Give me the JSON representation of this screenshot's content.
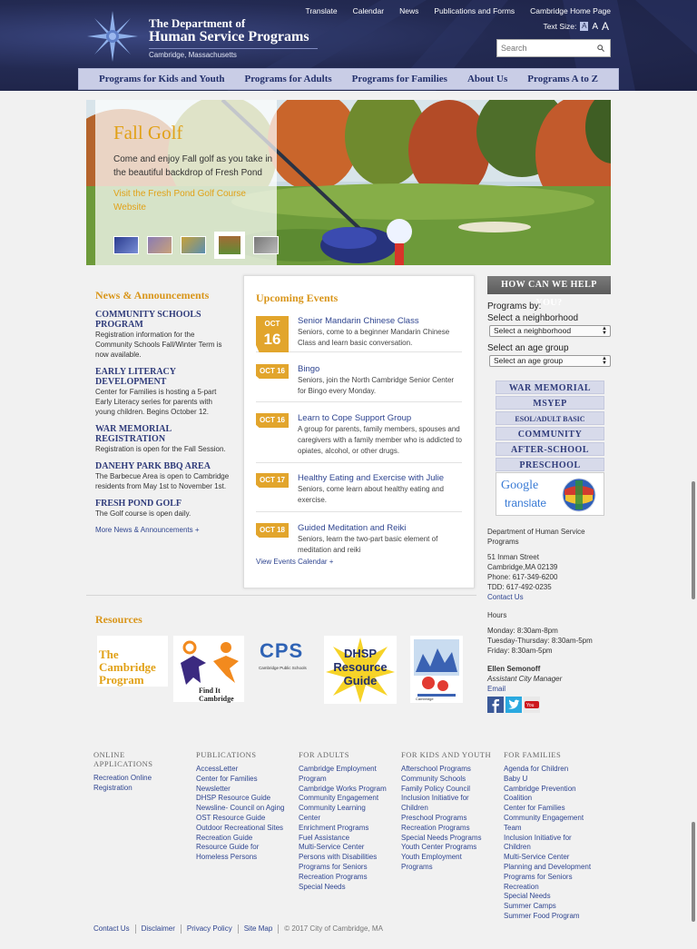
{
  "header": {
    "org_line1": "The Department of",
    "org_line2": "Human Service Programs",
    "org_line3": "Cambridge, Massachusetts",
    "util_nav": [
      "Translate",
      "Calendar",
      "News",
      "Publications and Forms",
      "Cambridge Home Page"
    ],
    "text_size_label": "Text Size:",
    "text_size_options": [
      "A",
      "A",
      "A"
    ],
    "search_placeholder": "Search"
  },
  "main_nav": [
    "Programs for Kids and Youth",
    "Programs for Adults",
    "Programs for Families",
    "About Us",
    "Programs A to Z"
  ],
  "hero": {
    "title": "Fall Golf",
    "text": "Come and enjoy Fall golf as you take in the beautiful backdrop of Fresh Pond",
    "link": "Visit the Fresh Pond Golf Course Website"
  },
  "news": {
    "heading": "News & Announcements",
    "items": [
      {
        "title": "Community Schools Program",
        "body": "Registration information for the Community Schools Fall/Winter Term is now available."
      },
      {
        "title": "Early Literacy Development",
        "body": "Center for Families is hosting a 5-part Early Literacy series for parents with young children. Begins October 12."
      },
      {
        "title": "War Memorial Registration",
        "body": "Registration is open for the Fall Session."
      },
      {
        "title": "Danehy Park BBQ Area",
        "body": "The Barbecue Area is open to Cambridge residents from May 1st to November 1st."
      },
      {
        "title": "Fresh Pond Golf",
        "body": "The Golf course is open daily."
      }
    ],
    "more": "More News & Announcements +"
  },
  "events": {
    "heading": "Upcoming Events",
    "items": [
      {
        "month": "OCT",
        "day": "16",
        "date": "OCT 16",
        "title": "Senior Mandarin Chinese Class",
        "body": "Seniors, come to a beginner Mandarin Chinese Class and learn basic conversation."
      },
      {
        "date": "OCT 16",
        "title": "Bingo",
        "body": "Seniors, join the North Cambridge Senior Center for Bingo every Monday."
      },
      {
        "date": "OCT 16",
        "title": "Learn to Cope Support Group",
        "body": "A group for parents, family members, spouses and caregivers with a family member who is addicted to opiates, alcohol, or other drugs."
      },
      {
        "date": "OCT 17",
        "title": "Healthy Eating and Exercise with Julie",
        "body": "Seniors, come learn about healthy eating and exercise."
      },
      {
        "date": "OCT 18",
        "title": "Guided Meditation and Reiki",
        "body": "Seniors, learn the two-part basic element of meditation and reiki"
      }
    ],
    "more": "View Events Calendar +"
  },
  "sidebar": {
    "help": "HOW CAN WE HELP YOU?",
    "programs_by": "Programs by:",
    "neighborhood_label": "Select a neighborhood",
    "neighborhood_value": "Select a neighborhood",
    "age_label": "Select an age group",
    "age_value": "Select an age group",
    "program_buttons": [
      "WAR MEMORIAL",
      "MSYEP",
      "ESOL/ADULT BASIC EDUCATION",
      "COMMUNITY SCHOOLS",
      "AFTER-SCHOOL",
      "PRESCHOOL"
    ],
    "google": "Google",
    "translate": "translate",
    "contact": {
      "org": "Department of Human Service Programs",
      "address1": "51 Inman Street",
      "address2": "Cambridge,MA 02139",
      "phone": "Phone: 617-349-6200",
      "tdd": "TDD: 617-492-0235",
      "contact_link": "Contact Us",
      "hours_heading": "Hours",
      "hours1": "Monday: 8:30am-8pm",
      "hours2": "Tuesday-Thursday: 8:30am-5pm",
      "hours3": "Friday: 8:30am-5pm",
      "name": "Ellen Semonoff",
      "role": "Assistant City Manager",
      "email": "Email"
    }
  },
  "resources": {
    "heading": "Resources",
    "logos": [
      {
        "text": "The Cambridge Program"
      },
      {
        "text": "Find It Cambridge"
      },
      {
        "text": "CPS",
        "sub": "Cambridge Public Schools"
      },
      {
        "text": "DHSP Resource Guide"
      },
      {
        "text": "Cambridge"
      }
    ]
  },
  "footer": {
    "columns": [
      {
        "heading": "Online Applications",
        "links": [
          "Recreation Online Registration"
        ]
      },
      {
        "heading": "Publications",
        "links": [
          "AccessLetter",
          "Center for Families Newsletter",
          "DHSP Resource Guide",
          "Newsline- Council on Aging",
          "OST Resource Guide",
          "Outdoor Recreational Sites",
          "Recreation Guide",
          "Resource Guide for Homeless Persons"
        ]
      },
      {
        "heading": "For Adults",
        "links": [
          "Cambridge Employment Program",
          "Cambridge Works Program",
          "Community Engagement",
          "Community Learning Center",
          "Enrichment Programs",
          "Fuel Assistance",
          "Multi-Service Center",
          "Persons with Disabilities",
          "Programs for Seniors",
          "Recreation Programs",
          "Special Needs"
        ]
      },
      {
        "heading": "For Kids and Youth",
        "links": [
          "Afterschool Programs",
          "Community Schools",
          "Family Policy Council",
          "Inclusion Initiative for Children",
          "Preschool Programs",
          "Recreation Programs",
          "Special Needs Programs",
          "Youth Center Programs",
          "Youth Employment Programs"
        ]
      },
      {
        "heading": "For Families",
        "links": [
          "Agenda for Children",
          "Baby U",
          "Cambridge Prevention Coalition",
          "Center for Families",
          "Community Engagement Team",
          "Inclusion Initiative for Children",
          "Multi-Service Center",
          "Planning and Development",
          "Programs for Seniors",
          "Recreation",
          "Special Needs",
          "Summer Camps",
          "Summer Food Program"
        ]
      }
    ],
    "legal": [
      "Contact Us",
      "Disclaimer",
      "Privacy Policy",
      "Site Map"
    ],
    "copyright": "© 2017 City of Cambridge, MA"
  }
}
